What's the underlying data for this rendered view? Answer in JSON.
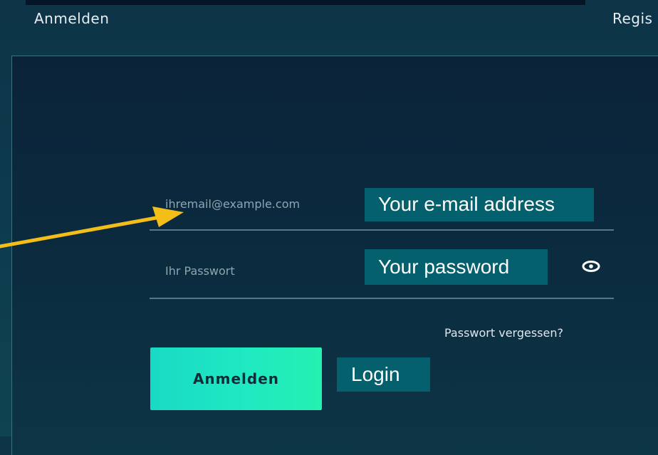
{
  "tabs": {
    "login": "Anmelden",
    "register": "Regis"
  },
  "form": {
    "email_placeholder": "ihremail@example.com",
    "password_placeholder": "Ihr Passwort",
    "forgot_password": "Passwort vergessen?",
    "login_button": "Anmelden"
  },
  "callouts": {
    "email": "Your e-mail address",
    "password": "Your password",
    "login": "Login"
  },
  "colors": {
    "accent": "#1EE8C3",
    "callout_bg": "#05606D",
    "arrow": "#F4BE19"
  },
  "icons": {
    "password_visibility": "eye-icon"
  }
}
